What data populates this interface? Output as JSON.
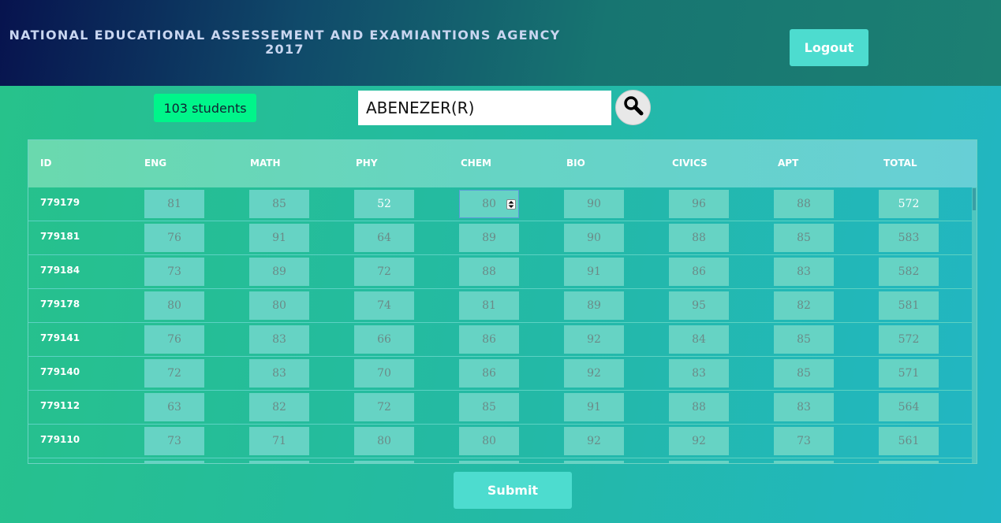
{
  "header": {
    "title_line1": "NATIONAL EDUCATIONAL ASSESSEMENT AND EXAMIANTIONS AGENCY",
    "title_line2": "2017",
    "logout_label": "Logout"
  },
  "toolbar": {
    "student_count": "103 students",
    "search_value": "ABENEZER(R)",
    "search_icon": "magnifier-icon"
  },
  "table": {
    "columns": [
      "ID",
      "ENG",
      "MATH",
      "PHY",
      "CHEM",
      "BIO",
      "CIVICS",
      "APT",
      "TOTAL"
    ],
    "rows": [
      {
        "id": "779179",
        "scores": [
          "81",
          "85",
          "52",
          "80",
          "90",
          "96",
          "88",
          "572"
        ]
      },
      {
        "id": "779181",
        "scores": [
          "76",
          "91",
          "64",
          "89",
          "90",
          "88",
          "85",
          "583"
        ]
      },
      {
        "id": "779184",
        "scores": [
          "73",
          "89",
          "72",
          "88",
          "91",
          "86",
          "83",
          "582"
        ]
      },
      {
        "id": "779178",
        "scores": [
          "80",
          "80",
          "74",
          "81",
          "89",
          "95",
          "82",
          "581"
        ]
      },
      {
        "id": "779141",
        "scores": [
          "76",
          "83",
          "66",
          "86",
          "92",
          "84",
          "85",
          "572"
        ]
      },
      {
        "id": "779140",
        "scores": [
          "72",
          "83",
          "70",
          "86",
          "92",
          "83",
          "85",
          "571"
        ]
      },
      {
        "id": "779112",
        "scores": [
          "63",
          "82",
          "72",
          "85",
          "91",
          "88",
          "83",
          "564"
        ]
      },
      {
        "id": "779110",
        "scores": [
          "73",
          "71",
          "80",
          "80",
          "92",
          "92",
          "73",
          "561"
        ]
      }
    ]
  },
  "footer": {
    "submit_label": "Submit"
  },
  "colors": {
    "accent": "#4ddccf",
    "badge": "#00f58a",
    "header_dark": "#07134e"
  }
}
